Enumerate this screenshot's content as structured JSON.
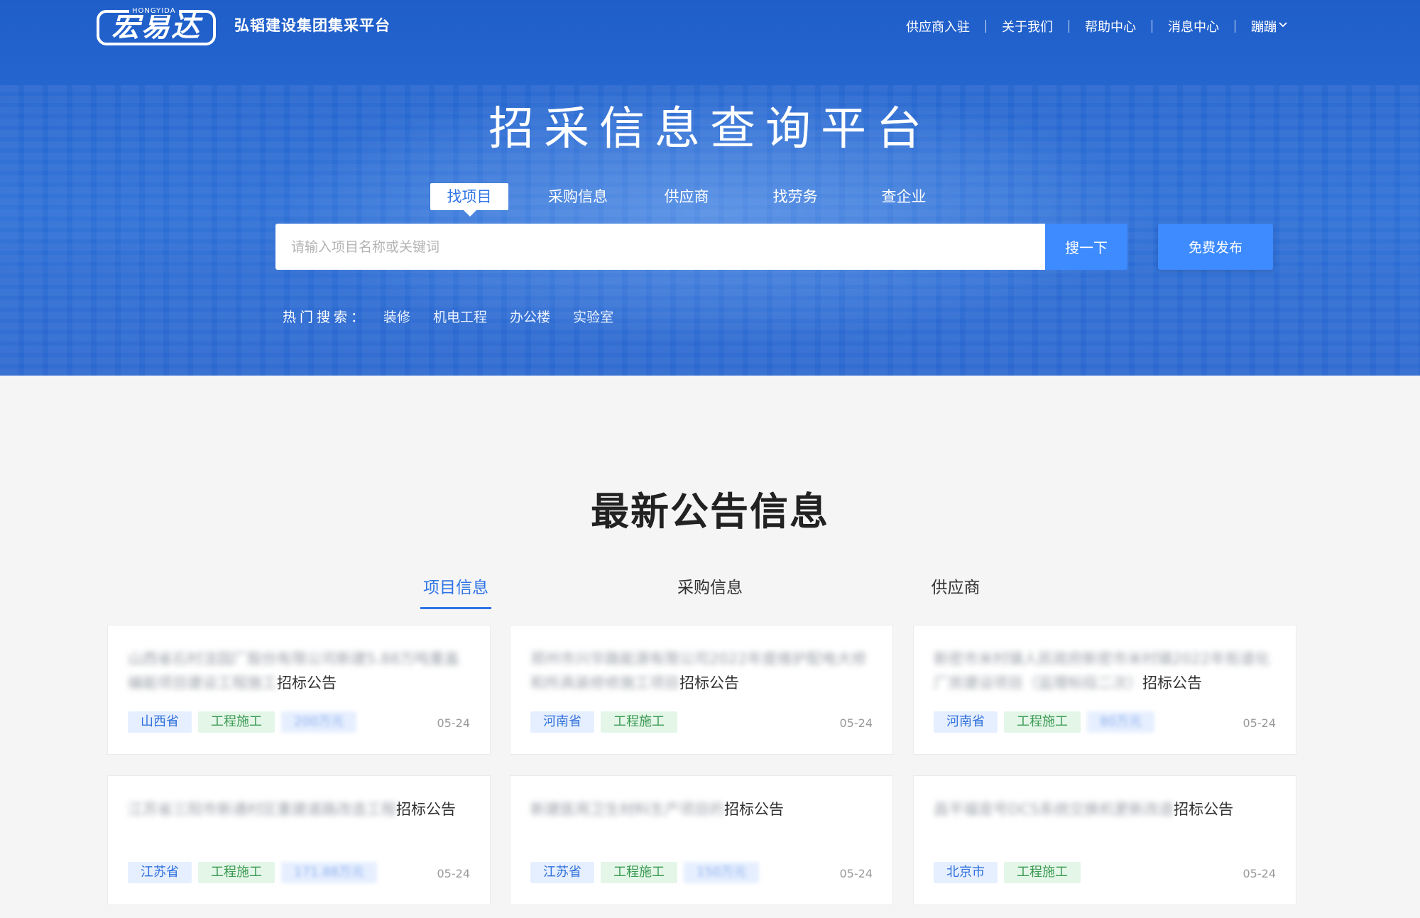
{
  "header": {
    "logo_text": "宏易达",
    "logo_en": "HONGYIDA",
    "site_name": "弘韬建设集团集采平台",
    "nav": [
      "供应商入驻",
      "关于我们",
      "帮助中心",
      "消息中心",
      "蹦蹦"
    ]
  },
  "hero": {
    "title": "招采信息查询平台",
    "search_tabs": [
      "找项目",
      "采购信息",
      "供应商",
      "找劳务",
      "查企业"
    ],
    "active_tab": 0,
    "search_placeholder": "请输入项目名称或关键词",
    "search_button": "搜一下",
    "publish_button": "免费发布",
    "hot_label": "热门搜索：",
    "hot_items": [
      "装修",
      "机电工程",
      "办公楼",
      "实验室"
    ]
  },
  "latest": {
    "title": "最新公告信息",
    "tabs": [
      "项目信息",
      "采购信息",
      "供应商"
    ],
    "active_tab": 0,
    "cards": [
      {
        "blurred": "山西省石村洼园厂股份有限公司新建5.88万吨重盖编能项目建设工程施工",
        "suffix": "招标公告",
        "region": "山西省",
        "type": "工程施工",
        "extra": "200万元",
        "date": "05-24"
      },
      {
        "blurred": "郑州市兴华路能源有限公司2022年度维护配电大修和所具装修修施工项目",
        "suffix": "招标公告",
        "region": "河南省",
        "type": "工程施工",
        "extra": "",
        "date": "05-24"
      },
      {
        "blurred": "新密市米村镇人民政府新密市米村镇2022年街道化厂房建设项目（监理标段二次）",
        "suffix": "招标公告",
        "region": "河南省",
        "type": "工程施工",
        "extra": "80万元",
        "date": "05-24"
      },
      {
        "blurred": "江苏省三阳市新通村区重建道路改造工程",
        "suffix": "招标公告",
        "region": "江苏省",
        "type": "工程施工",
        "extra": "171.88万元",
        "date": "05-24"
      },
      {
        "blurred": "新建医用卫生材料生产项目的",
        "suffix": "招标公告",
        "region": "江苏省",
        "type": "工程施工",
        "extra": "150万元",
        "date": "05-24"
      },
      {
        "blurred": "昌平福音号DCS系统交换机更新改造",
        "suffix": "招标公告",
        "region": "北京市",
        "type": "工程施工",
        "extra": "",
        "date": "05-24"
      }
    ]
  }
}
